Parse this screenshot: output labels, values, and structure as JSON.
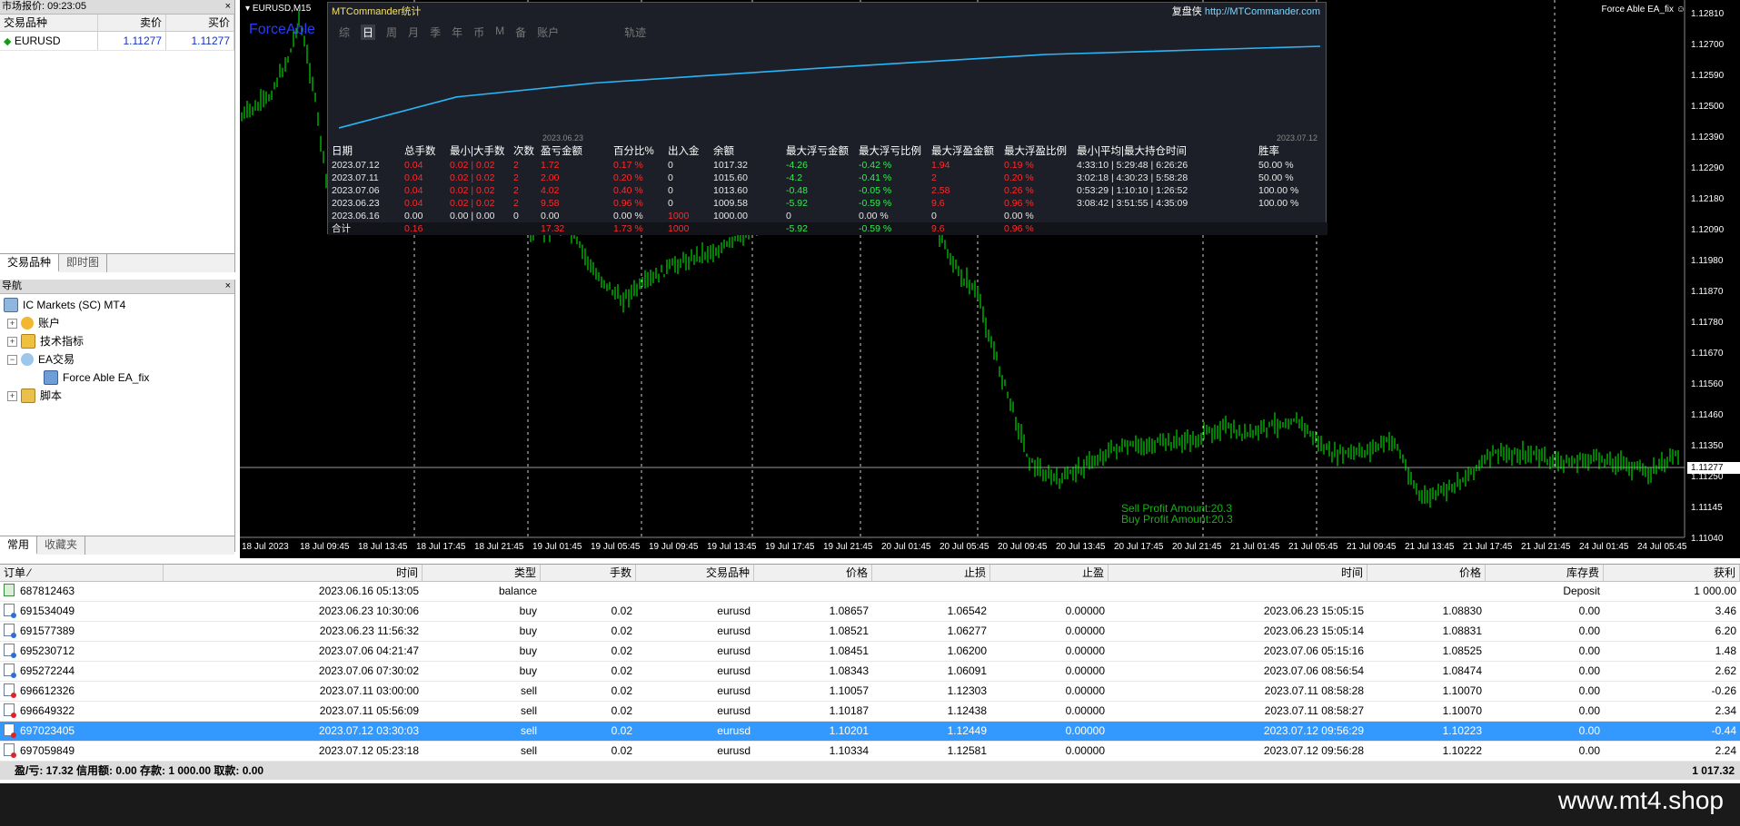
{
  "market_watch": {
    "title": "市场报价: 09:23:05",
    "col_symbol": "交易品种",
    "col_bid": "卖价",
    "col_ask": "买价",
    "rows": [
      {
        "symbol": "EURUSD",
        "bid": "1.11277",
        "ask": "1.11277"
      }
    ],
    "tab_symbols": "交易品种",
    "tab_tick": "即时图"
  },
  "navigator": {
    "title": "导航",
    "items": [
      "IC Markets (SC) MT4",
      "账户",
      "技术指标",
      "EA交易",
      "Force Able EA_fix",
      "脚本"
    ],
    "tab_common": "常用",
    "tab_favorites": "收藏夹"
  },
  "chart": {
    "symbol_tf": "EURUSD,M15",
    "ea_name": "Force Able EA_fix",
    "ea_overlay": "ForceAble",
    "price_levels": [
      "1.12810",
      "1.12700",
      "1.12590",
      "1.12500",
      "1.12390",
      "1.12290",
      "1.12180",
      "1.12090",
      "1.11980",
      "1.11870",
      "1.11780",
      "1.11670",
      "1.11560",
      "1.11460",
      "1.11350",
      "1.11250",
      "1.11145",
      "1.11040"
    ],
    "current_price": "1.11277",
    "time_labels": [
      "18 Jul 2023",
      "18 Jul 09:45",
      "18 Jul 13:45",
      "18 Jul 17:45",
      "18 Jul 21:45",
      "19 Jul 01:45",
      "19 Jul 05:45",
      "19 Jul 09:45",
      "19 Jul 13:45",
      "19 Jul 17:45",
      "19 Jul 21:45",
      "20 Jul 01:45",
      "20 Jul 05:45",
      "20 Jul 09:45",
      "20 Jul 13:45",
      "20 Jul 17:45",
      "20 Jul 21:45",
      "21 Jul 01:45",
      "21 Jul 05:45",
      "21 Jul 09:45",
      "21 Jul 13:45",
      "21 Jul 17:45",
      "21 Jul 21:45",
      "24 Jul 01:45",
      "24 Jul 05:45"
    ],
    "sell_profit": "Sell Profit Amount:20.3",
    "buy_profit": "Buy Profit Amount:20.3"
  },
  "stats": {
    "title": "MTCommander统计",
    "link_label": "复盘侠",
    "link_url": "http://MTCommander.com",
    "periods": [
      "综",
      "日",
      "周",
      "月",
      "季",
      "年",
      "币",
      "M",
      "备",
      "账户",
      "轨迹"
    ],
    "date_start": "2023.06.23",
    "date_end": "2023.07.12",
    "headers": [
      "日期",
      "总手数",
      "最小|大手数",
      "次数",
      "盈亏金额",
      "百分比%",
      "出入金",
      "余额",
      "最大浮亏金额",
      "最大浮亏比例",
      "最大浮盈金额",
      "最大浮盈比例",
      "最小|平均|最大持仓时间",
      "胜率"
    ],
    "rows": [
      [
        "2023.07.12",
        "0.04",
        "0.02 | 0.02",
        "2",
        "1.72",
        "0.17 %",
        "0",
        "1017.32",
        "-4.26",
        "-0.42 %",
        "1.94",
        "0.19 %",
        "4:33:10 | 5:29:48 | 6:26:26",
        "50.00 %"
      ],
      [
        "2023.07.11",
        "0.04",
        "0.02 | 0.02",
        "2",
        "2.00",
        "0.20 %",
        "0",
        "1015.60",
        "-4.2",
        "-0.41 %",
        "2",
        "0.20 %",
        "3:02:18 | 4:30:23 | 5:58:28",
        "50.00 %"
      ],
      [
        "2023.07.06",
        "0.04",
        "0.02 | 0.02",
        "2",
        "4.02",
        "0.40 %",
        "0",
        "1013.60",
        "-0.48",
        "-0.05 %",
        "2.58",
        "0.26 %",
        "0:53:29 | 1:10:10 | 1:26:52",
        "100.00 %"
      ],
      [
        "2023.06.23",
        "0.04",
        "0.02 | 0.02",
        "2",
        "9.58",
        "0.96 %",
        "0",
        "1009.58",
        "-5.92",
        "-0.59 %",
        "9.6",
        "0.96 %",
        "3:08:42 | 3:51:55 | 4:35:09",
        "100.00 %"
      ],
      [
        "2023.06.16",
        "0.00",
        "0.00 | 0.00",
        "0",
        "0.00",
        "0.00 %",
        "1000",
        "1000.00",
        "0",
        "0.00 %",
        "0",
        "0.00 %",
        "",
        ""
      ]
    ],
    "total": [
      "合计",
      "0.16",
      "",
      "",
      "17.32",
      "1.73 %",
      "1000",
      "",
      "-5.92",
      "-0.59 %",
      "9.6",
      "0.96 %",
      "",
      ""
    ],
    "equity_curve": [
      0,
      0.38,
      0.55,
      0.74,
      0.9,
      1.0
    ]
  },
  "orders": {
    "headers": [
      "订单",
      "时间",
      "类型",
      "手数",
      "交易品种",
      "价格",
      "止损",
      "止盈",
      "时间",
      "价格",
      "库存费",
      "获利"
    ],
    "rows": [
      {
        "id": "687812463",
        "time": "2023.06.16 05:13:05",
        "type": "balance",
        "lots": "",
        "symbol": "",
        "price": "",
        "sl": "",
        "tp": "",
        "ctime": "",
        "cprice": "",
        "swap": "Deposit",
        "profit": "1 000.00"
      },
      {
        "id": "691534049",
        "time": "2023.06.23 10:30:06",
        "type": "buy",
        "lots": "0.02",
        "symbol": "eurusd",
        "price": "1.08657",
        "sl": "1.06542",
        "tp": "0.00000",
        "ctime": "2023.06.23 15:05:15",
        "cprice": "1.08830",
        "swap": "0.00",
        "profit": "3.46"
      },
      {
        "id": "691577389",
        "time": "2023.06.23 11:56:32",
        "type": "buy",
        "lots": "0.02",
        "symbol": "eurusd",
        "price": "1.08521",
        "sl": "1.06277",
        "tp": "0.00000",
        "ctime": "2023.06.23 15:05:14",
        "cprice": "1.08831",
        "swap": "0.00",
        "profit": "6.20"
      },
      {
        "id": "695230712",
        "time": "2023.07.06 04:21:47",
        "type": "buy",
        "lots": "0.02",
        "symbol": "eurusd",
        "price": "1.08451",
        "sl": "1.06200",
        "tp": "0.00000",
        "ctime": "2023.07.06 05:15:16",
        "cprice": "1.08525",
        "swap": "0.00",
        "profit": "1.48"
      },
      {
        "id": "695272244",
        "time": "2023.07.06 07:30:02",
        "type": "buy",
        "lots": "0.02",
        "symbol": "eurusd",
        "price": "1.08343",
        "sl": "1.06091",
        "tp": "0.00000",
        "ctime": "2023.07.06 08:56:54",
        "cprice": "1.08474",
        "swap": "0.00",
        "profit": "2.62"
      },
      {
        "id": "696612326",
        "time": "2023.07.11 03:00:00",
        "type": "sell",
        "lots": "0.02",
        "symbol": "eurusd",
        "price": "1.10057",
        "sl": "1.12303",
        "tp": "0.00000",
        "ctime": "2023.07.11 08:58:28",
        "cprice": "1.10070",
        "swap": "0.00",
        "profit": "-0.26"
      },
      {
        "id": "696649322",
        "time": "2023.07.11 05:56:09",
        "type": "sell",
        "lots": "0.02",
        "symbol": "eurusd",
        "price": "1.10187",
        "sl": "1.12438",
        "tp": "0.00000",
        "ctime": "2023.07.11 08:58:27",
        "cprice": "1.10070",
        "swap": "0.00",
        "profit": "2.34"
      },
      {
        "id": "697023405",
        "time": "2023.07.12 03:30:03",
        "type": "sell",
        "lots": "0.02",
        "symbol": "eurusd",
        "price": "1.10201",
        "sl": "1.12449",
        "tp": "0.00000",
        "ctime": "2023.07.12 09:56:29",
        "cprice": "1.10223",
        "swap": "0.00",
        "profit": "-0.44"
      },
      {
        "id": "697059849",
        "time": "2023.07.12 05:23:18",
        "type": "sell",
        "lots": "0.02",
        "symbol": "eurusd",
        "price": "1.10334",
        "sl": "1.12581",
        "tp": "0.00000",
        "ctime": "2023.07.12 09:56:28",
        "cprice": "1.10222",
        "swap": "0.00",
        "profit": "2.24"
      }
    ],
    "selected_index": 7,
    "summary": "盈/亏: 17.32  信用额: 0.00  存款: 1 000.00  取款: 0.00",
    "summary_total": "1 017.32"
  },
  "watermark": "www.mt4.shop",
  "colors": {
    "candle": "#00ff00",
    "equity": "#29b6f6",
    "loss": "#ff2a2a",
    "gain": "#2df04a",
    "selection": "#3399ff"
  }
}
